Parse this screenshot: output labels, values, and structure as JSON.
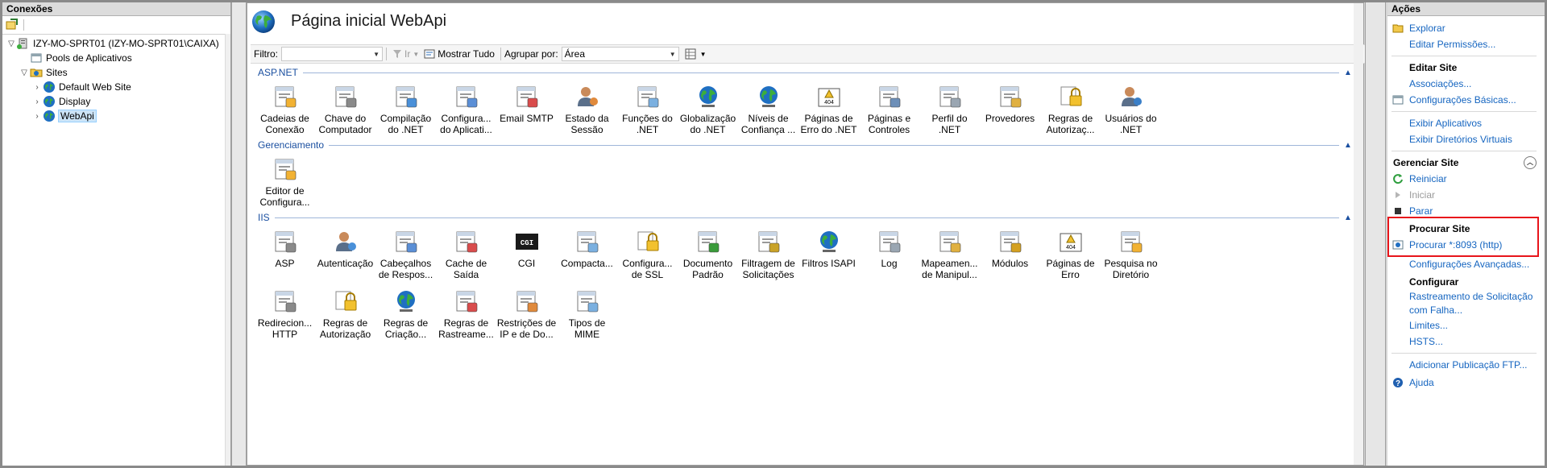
{
  "connections": {
    "header": "Conexões",
    "tree": [
      {
        "label": "IZY-MO-SPRT01 (IZY-MO-SPRT01\\CAIXA)",
        "indent": 0,
        "exp": "▽",
        "icon": "server-icon"
      },
      {
        "label": "Pools de Aplicativos",
        "indent": 1,
        "exp": "",
        "icon": "app-pool-icon"
      },
      {
        "label": "Sites",
        "indent": 1,
        "exp": "▽",
        "icon": "sites-folder-icon"
      },
      {
        "label": "Default Web Site",
        "indent": 2,
        "exp": "›",
        "icon": "globe-icon"
      },
      {
        "label": "Display",
        "indent": 2,
        "exp": "›",
        "icon": "globe-icon"
      },
      {
        "label": "WebApi",
        "indent": 2,
        "exp": "›",
        "icon": "globe-icon",
        "selected": true
      }
    ]
  },
  "center": {
    "title": "Página inicial WebApi",
    "filter": {
      "label": "Filtro:",
      "value": "",
      "go_label": "Ir",
      "show_all_label": "Mostrar Tudo",
      "group_by_label": "Agrupar por:",
      "group_by_value": "Área"
    },
    "groups": [
      {
        "name": "ASP.NET",
        "items": [
          {
            "label": "Cadeias de\nConexão",
            "icon": "connection-strings-icon"
          },
          {
            "label": "Chave do\nComputador",
            "icon": "machine-key-icon"
          },
          {
            "label": "Compilação\ndo .NET",
            "icon": "compilation-icon"
          },
          {
            "label": "Configura...\ndo Aplicati...",
            "icon": "app-settings-icon"
          },
          {
            "label": "Email SMTP",
            "icon": "smtp-email-icon"
          },
          {
            "label": "Estado da\nSessão",
            "icon": "session-state-icon"
          },
          {
            "label": "Funções do\n.NET",
            "icon": "net-roles-icon"
          },
          {
            "label": "Globalização\ndo .NET",
            "icon": "globalization-icon"
          },
          {
            "label": "Níveis de\nConfiança ...",
            "icon": "trust-levels-icon"
          },
          {
            "label": "Páginas de\nErro do .NET",
            "icon": "error-pages-icon"
          },
          {
            "label": "Páginas e\nControles",
            "icon": "pages-controls-icon"
          },
          {
            "label": "Perfil do .NET",
            "icon": "net-profile-icon"
          },
          {
            "label": "Provedores",
            "icon": "providers-icon"
          },
          {
            "label": "Regras de\nAutorizaç...",
            "icon": "authorization-rules-icon"
          },
          {
            "label": "Usuários do\n.NET",
            "icon": "net-users-icon"
          }
        ]
      },
      {
        "name": "Gerenciamento",
        "items": [
          {
            "label": "Editor de\nConfigura...",
            "icon": "config-editor-icon"
          }
        ]
      },
      {
        "name": "IIS",
        "items": [
          {
            "label": "ASP",
            "icon": "asp-icon"
          },
          {
            "label": "Autenticação",
            "icon": "authentication-icon"
          },
          {
            "label": "Cabeçalhos\nde Respos...",
            "icon": "response-headers-icon"
          },
          {
            "label": "Cache de\nSaída",
            "icon": "output-cache-icon"
          },
          {
            "label": "CGI",
            "icon": "cgi-icon"
          },
          {
            "label": "Compacta...",
            "icon": "compression-icon"
          },
          {
            "label": "Configura...\nde SSL",
            "icon": "ssl-settings-icon"
          },
          {
            "label": "Documento\nPadrão",
            "icon": "default-document-icon"
          },
          {
            "label": "Filtragem de\nSolicitações",
            "icon": "request-filtering-icon"
          },
          {
            "label": "Filtros ISAPI",
            "icon": "isapi-filters-icon"
          },
          {
            "label": "Log",
            "icon": "log-icon"
          },
          {
            "label": "Mapeamen...\nde Manipul...",
            "icon": "handler-mappings-icon"
          },
          {
            "label": "Módulos",
            "icon": "modules-icon"
          },
          {
            "label": "Páginas de\nErro",
            "icon": "iis-error-pages-icon"
          },
          {
            "label": "Pesquisa no\nDiretório",
            "icon": "directory-browsing-icon"
          },
          {
            "label": "Redirecion...\nHTTP",
            "icon": "http-redirect-icon"
          },
          {
            "label": "Regras de\nAutorização",
            "icon": "iis-authorization-icon"
          },
          {
            "label": "Regras de\nCriação...",
            "icon": "webdav-rules-icon"
          },
          {
            "label": "Regras de\nRastreame...",
            "icon": "tracing-rules-icon"
          },
          {
            "label": "Restrições de\nIP e de Do...",
            "icon": "ip-restrictions-icon"
          },
          {
            "label": "Tipos de\nMIME",
            "icon": "mime-types-icon"
          }
        ]
      }
    ]
  },
  "actions": {
    "header": "Ações",
    "explore": "Explorar",
    "edit_permissions": "Editar Permissões...",
    "edit_site_head": "Editar Site",
    "bindings": "Associações...",
    "basic_settings": "Configurações Básicas...",
    "view_apps": "Exibir Aplicativos",
    "view_vdirs": "Exibir Diretórios Virtuais",
    "manage_site_head": "Gerenciar Site",
    "restart": "Reiniciar",
    "start": "Iniciar",
    "stop": "Parar",
    "browse_head": "Procurar Site",
    "browse_link": "Procurar *:8093 (http)",
    "advanced_settings": "Configurações Avançadas...",
    "configure_head": "Configurar",
    "failed_request": "Rastreamento de Solicitação",
    "failed_request2": "com Falha...",
    "limits": "Limites...",
    "hsts": "HSTS...",
    "ftp_publish": "Adicionar Publicação FTP...",
    "help": "Ajuda"
  }
}
